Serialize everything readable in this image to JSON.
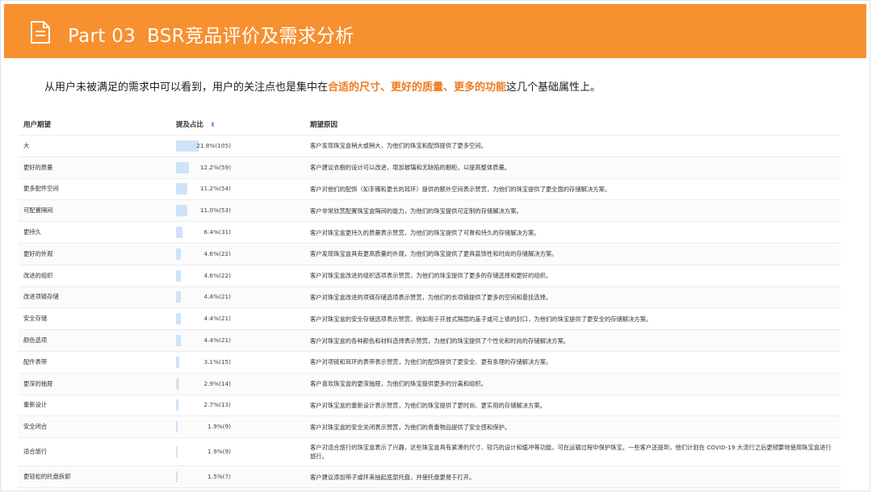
{
  "header": {
    "part": "Part 03",
    "title": "BSR竞品评价及需求分析"
  },
  "intro": {
    "prefix": "从用户未被满足的需求中可以看到，用户的关注点也是集中在",
    "highlight": "合适的尺寸、更好的质量、更多的功能",
    "suffix": "这几个基础属性上。"
  },
  "table": {
    "headers": {
      "expectation": "用户期望",
      "ratio": "提及占比",
      "reason": "期望原因"
    },
    "rows": [
      {
        "expectation": "大",
        "ratio_text": "21.8%(105)",
        "ratio": 21.8,
        "reason": "客户发现珠宝盒稍大或稍大，为他们的珠宝和配饰提供了更多空间。"
      },
      {
        "expectation": "更好的质量",
        "ratio_text": "12.2%(59)",
        "ratio": 12.2,
        "reason": "客户建议衣橱的设计可以改进，增加玻璃和无缺陷的橱柜，以提高整体质量。"
      },
      {
        "expectation": "更多配件空间",
        "ratio_text": "11.2%(54)",
        "ratio": 11.2,
        "reason": "客户对他们的配饰（如手镯和更长的耳环）提供的额外空间表示赞赏，为他们的珠宝提供了更全面的存储解决方案。"
      },
      {
        "expectation": "可配置隔间",
        "ratio_text": "11.0%(53)",
        "ratio": 11.0,
        "reason": "客户非常欣赏配置珠宝盒隔间的能力，为他们的珠宝提供可定制的存储解决方案。"
      },
      {
        "expectation": "更持久",
        "ratio_text": "6.4%(31)",
        "ratio": 6.4,
        "reason": "客户对珠宝盒更持久的质量表示赞赏，为他们的珠宝提供了可靠和持久的存储解决方案。"
      },
      {
        "expectation": "更好的外观",
        "ratio_text": "4.6%(22)",
        "ratio": 4.6,
        "reason": "客户发现珠宝盒具有更高质量的外观，为他们的珠宝提供了更具装饰性和时尚的存储解决方案。"
      },
      {
        "expectation": "改进的组织",
        "ratio_text": "4.6%(22)",
        "ratio": 4.6,
        "reason": "客户对珠宝盒改进的组织选项表示赞赏，为他们的珠宝提供了更多的存储选择和更好的组织。"
      },
      {
        "expectation": "改进项链存储",
        "ratio_text": "4.4%(21)",
        "ratio": 4.4,
        "reason": "客户对珠宝盒改进的项链存储选项表示赞赏，为他们的长项链提供了更多的空间和悬挂选择。"
      },
      {
        "expectation": "安全存储",
        "ratio_text": "4.4%(21)",
        "ratio": 4.4,
        "reason": "客户对珠宝盒的安全存储选项表示赞赏，例如用于开放式隔层的盖子或可上锁的封口，为他们的珠宝提供了更安全的存储解决方案。"
      },
      {
        "expectation": "颜色选项",
        "ratio_text": "4.4%(21)",
        "ratio": 4.4,
        "reason": "客户对珠宝盒的各种颜色和材料选择表示赞赏，为他们的珠宝提供了个性化和时尚的存储解决方案。"
      },
      {
        "expectation": "配件表带",
        "ratio_text": "3.1%(15)",
        "ratio": 3.1,
        "reason": "客户对项链和耳环的表带表示赞赏，为他们的配饰提供了更安全、更有条理的存储解决方案。"
      },
      {
        "expectation": "更深的抽屉",
        "ratio_text": "2.9%(14)",
        "ratio": 2.9,
        "reason": "客户喜欢珠宝盒的更深抽屉，为他们的珠宝提供更多的分离和组织。"
      },
      {
        "expectation": "重新设计",
        "ratio_text": "2.7%(13)",
        "ratio": 2.7,
        "reason": "客户对珠宝盒的重新设计表示赞赏，为他们的珠宝提供了更时尚、更实用的存储解决方案。"
      },
      {
        "expectation": "安全闭合",
        "ratio_text": "1.9%(9)",
        "ratio": 1.9,
        "reason": "客户对珠宝盒的安全关闭表示赞赏，为他们的贵重物品提供了安全感和保护。"
      },
      {
        "expectation": "适合旅行",
        "ratio_text": "1.9%(9)",
        "ratio": 1.9,
        "reason": "客户对适合旅行的珠宝盒表示了兴趣，这些珠宝盒具有紧凑的尺寸、轻巧的设计和缓冲等功能，可在运输过程中保护珠宝。一些客户还提到，他们计划在 COVID-19 大流行之后更频繁地使用珠宝盒进行旅行。",
        "tall": true
      },
      {
        "expectation": "更轻松的托盘拆卸",
        "ratio_text": "1.5%(7)",
        "ratio": 1.5,
        "reason": "客户建议添加带子或环来抽起底部托盘，并使托盘更易于打开。"
      }
    ]
  },
  "colors": {
    "accent": "#f7902f",
    "highlight": "#f07a1e",
    "bar": "#cfe3f8"
  },
  "icons": {
    "header": "document-icon",
    "sort": "sort-icon"
  }
}
